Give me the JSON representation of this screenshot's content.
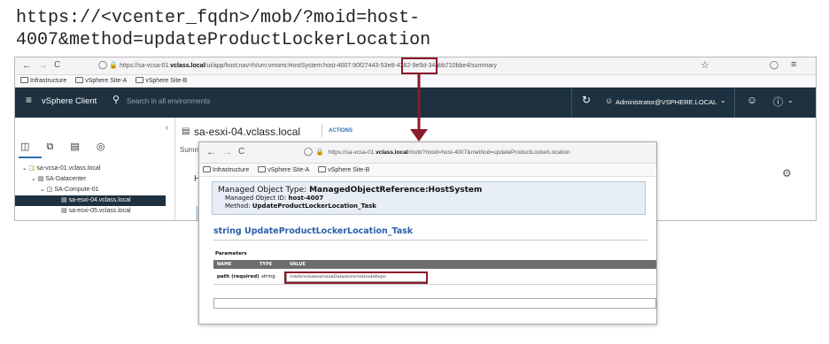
{
  "caption": {
    "line1": "https://<vcenter_fqdn>/mob/?moid=host-",
    "line2": "4007&method=updateProductLockerLocation"
  },
  "colors": {
    "highlight": "#8b1a2a",
    "app_header": "#1d3140",
    "method_title": "#2b5fa8"
  },
  "back_window": {
    "nav": {
      "back": "←",
      "forward": "→",
      "reload": "C"
    },
    "url_before": "https://sa-vcsa-01.",
    "url_bold": "vclass.local",
    "url_after": "/ui/app/host;nav=h/urn:vmomi:HostSystem:",
    "url_host": "host-4007",
    "url_tail": ":90f27443-53e8-4382-9e5d-34abb710bbe4/summary",
    "bookmarks": [
      "Infrastructure",
      "vSphere Site-A",
      "vSphere Site-B"
    ],
    "app_title": "vSphere Client",
    "search_placeholder": "Search in all environments",
    "user": "Administrator@VSPHERE.LOCAL",
    "host_title": "sa-esxi-04.vclass.local",
    "actions": "ACTIONS",
    "tab_stub": "Summ",
    "panel_stub": "Ho",
    "tree": [
      {
        "label": "sa-vcsa-01.vclass.local",
        "indent": 1
      },
      {
        "label": "SA-Datacenter",
        "indent": 2
      },
      {
        "label": "SA-Compute-01",
        "indent": 3
      },
      {
        "label": "sa-esxi-04.vclass.local",
        "indent": 4,
        "selected": true
      },
      {
        "label": "sa-esxi-05.vclass.local",
        "indent": 4
      }
    ]
  },
  "front_window": {
    "nav": {
      "back": "←",
      "forward": "→",
      "reload": "C"
    },
    "url_before": "https://sa-vcsa-01.",
    "url_bold": "vclass.local",
    "url_after": "/mob/?moid=host-4007&method=updateProductLockerLocation",
    "bookmarks": [
      "Infrastructure",
      "vSphere Site-A",
      "vSphere Site-B"
    ],
    "mob_type_label": "Managed Object Type:",
    "mob_type_value": "ManagedObjectReference:HostSystem",
    "mob_id_label": "Managed Object ID:",
    "mob_id_value": "host-4007",
    "method_label": "Method:",
    "method_value": "UpdateProductLockerLocation_Task",
    "method_title": "string UpdateProductLockerLocation_Task",
    "params_label": "Parameters",
    "columns": [
      "NAME",
      "TYPE",
      "VALUE"
    ],
    "param": {
      "name": "path (required)",
      "type": "string",
      "value": "/vmfs/volumes/vsanDatastore/vmtoolsRepo"
    }
  }
}
